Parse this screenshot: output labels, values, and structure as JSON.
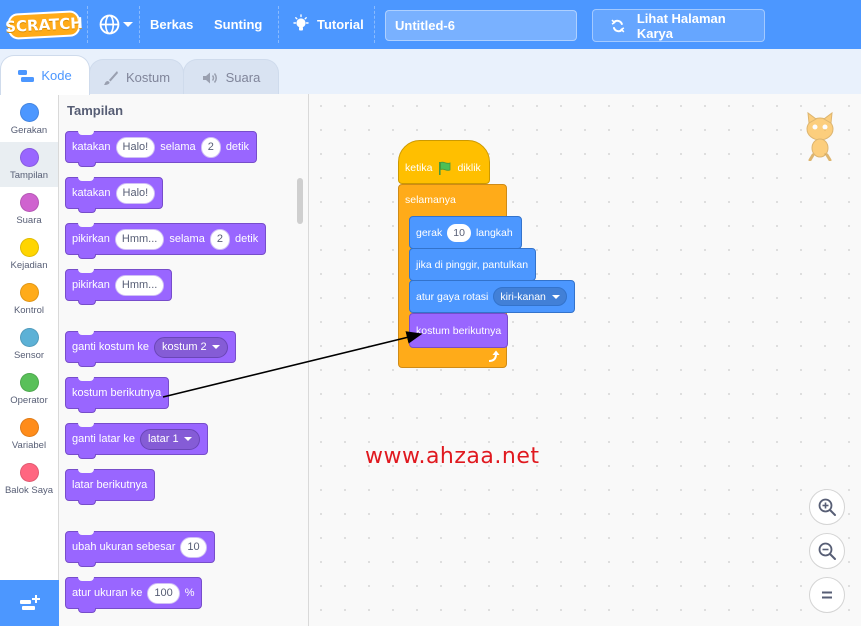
{
  "menubar": {
    "logo_text": "SCRATCH",
    "file_label": "Berkas",
    "edit_label": "Sunting",
    "tutorial_label": "Tutorial",
    "project_title": "Untitled-6",
    "project_page_label": "Lihat Halaman Karya",
    "icons": [
      "globe-icon",
      "lightbulb-icon",
      "see-project-icon"
    ],
    "bar_color": "#4c97ff"
  },
  "tabs": [
    {
      "label": "Kode",
      "icon": "code-icon",
      "active": true
    },
    {
      "label": "Kostum",
      "icon": "brush-icon",
      "active": false
    },
    {
      "label": "Suara",
      "icon": "speaker-icon",
      "active": false
    }
  ],
  "categories": [
    {
      "label": "Gerakan",
      "color": "#4c97ff"
    },
    {
      "label": "Tampilan",
      "color": "#9966ff",
      "active": true
    },
    {
      "label": "Suara",
      "color": "#cf63cf"
    },
    {
      "label": "Kejadian",
      "color": "#ffd500"
    },
    {
      "label": "Kontrol",
      "color": "#ffab19"
    },
    {
      "label": "Sensor",
      "color": "#5cb1d6"
    },
    {
      "label": "Operator",
      "color": "#59c059"
    },
    {
      "label": "Variabel",
      "color": "#ff8c1a"
    },
    {
      "label": "Balok Saya",
      "color": "#ff6680"
    }
  ],
  "palette": {
    "section_title": "Tampilan",
    "blocks": [
      {
        "t1": "katakan",
        "v1": "Halo!",
        "t2": "selama",
        "v2": "2",
        "t3": "detik"
      },
      {
        "t1": "katakan",
        "v1": "Halo!"
      },
      {
        "t1": "pikirkan",
        "v1": "Hmm...",
        "t2": "selama",
        "v2": "2",
        "t3": "detik"
      },
      {
        "t1": "pikirkan",
        "v1": "Hmm..."
      },
      {
        "t1": "ganti kostum ke",
        "d1": "kostum 2"
      },
      {
        "t1": "kostum berikutnya"
      },
      {
        "t1": "ganti latar ke",
        "d1": "latar 1"
      },
      {
        "t1": "latar berikutnya"
      },
      {
        "t1": "ubah ukuran sebesar",
        "v1": "10"
      },
      {
        "t1": "atur ukuran ke",
        "v1": "100",
        "t2": "%"
      }
    ]
  },
  "script": {
    "hat_text1": "ketika",
    "hat_text2": "diklik",
    "forever_label": "selamanya",
    "move_label1": "gerak",
    "move_value": "10",
    "move_label2": "langkah",
    "bounce_label": "jika di pinggir, pantulkan",
    "rotation_label": "atur gaya rotasi",
    "rotation_value": "kiri-kanan",
    "next_costume_label": "kostum berikutnya"
  },
  "watermark": "www.ahzaa.net",
  "zoom": {
    "zoom_in": "+",
    "zoom_out": "−",
    "reset": "="
  }
}
